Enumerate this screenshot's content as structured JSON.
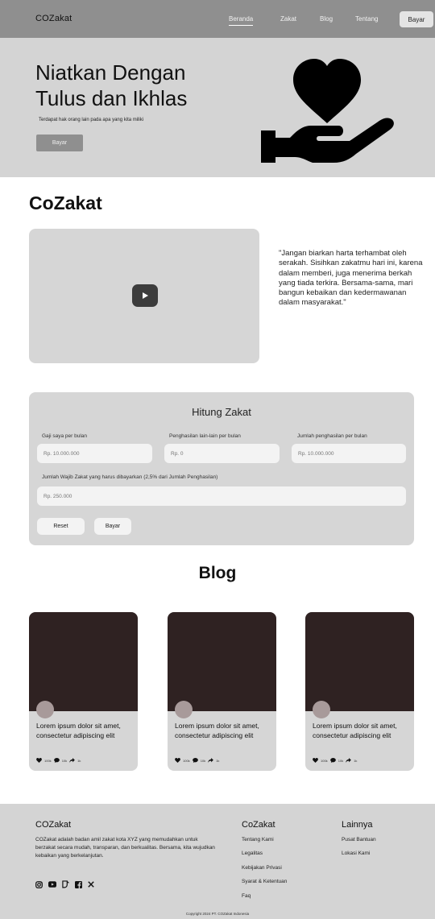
{
  "nav": {
    "brand": "COZakat",
    "links": [
      "Beranda",
      "Zakat",
      "Blog",
      "Tentang"
    ],
    "cta": "Bayar"
  },
  "hero": {
    "title": "Niatkan Dengan Tulus dan Ikhlas",
    "subtitle": "Terdapat hak orang lain pada apa yang kita miliki",
    "button": "Bayar",
    "icon": "heart-in-hand-icon"
  },
  "about": {
    "title": "CoZakat",
    "video_icon": "play-icon",
    "quote": "\"Jangan biarkan harta terhambat oleh serakah. Sisihkan zakatmu hari ini, karena dalam memberi, juga menerima berkah yang tiada terkira. Bersama-sama, mari bangun kebaikan dan kedermawanan dalam masyarakat.\""
  },
  "calculator": {
    "title": "Hitung Zakat",
    "fields": [
      {
        "label": "Gaji saya per bulan",
        "placeholder": "Rp. 10.000.000"
      },
      {
        "label": "Penghasilan lain-lain per bulan",
        "placeholder": "Rp. 0"
      },
      {
        "label": "Jumlah penghasilan per bulan",
        "placeholder": "Rp. 10.000.000"
      }
    ],
    "result": {
      "label": "Jumlah Wajib Zakat yang harus dibayarkan (2,5% dari Jumlah Penghasilan)",
      "placeholder": "Rp. 250.000"
    },
    "reset": "Reset",
    "pay": "Bayar"
  },
  "blog": {
    "title": "Blog",
    "cards": [
      {
        "text": "Lorem ipsum dolor sit amet, consectetur adipiscing elit",
        "likes": "100k",
        "comments": "10k",
        "shares": "1k"
      },
      {
        "text": "Lorem ipsum dolor sit amet, consectetur adipiscing elit",
        "likes": "100k",
        "comments": "10k",
        "shares": "1k"
      },
      {
        "text": "Lorem ipsum dolor sit amet, consectetur adipiscing elit",
        "likes": "100k",
        "comments": "10k",
        "shares": "1k"
      }
    ]
  },
  "footer": {
    "brand": "COZakat",
    "description": "COZakat adalah badan amil zakat kota XYZ yang memudahkan untuk berzakat secara mudah, transparan, dan berkualitas. Bersama, kita wujudkan kebaikan yang berkelanjutan.",
    "socials": [
      "instagram-icon",
      "youtube-icon",
      "tiktok-icon",
      "facebook-icon",
      "x-icon"
    ],
    "col1": {
      "title": "CoZakat",
      "links": [
        "Tentang Kami",
        "Legalitas",
        "Kebijakan Privasi",
        "Syarat & Ketentuan",
        "Faq"
      ]
    },
    "col2": {
      "title": "Lainnya",
      "links": [
        "Pusat Bantuan",
        "Lokasi Kami"
      ]
    },
    "copyright": "Copyright 2024 PT. COZakat Indonesia"
  }
}
